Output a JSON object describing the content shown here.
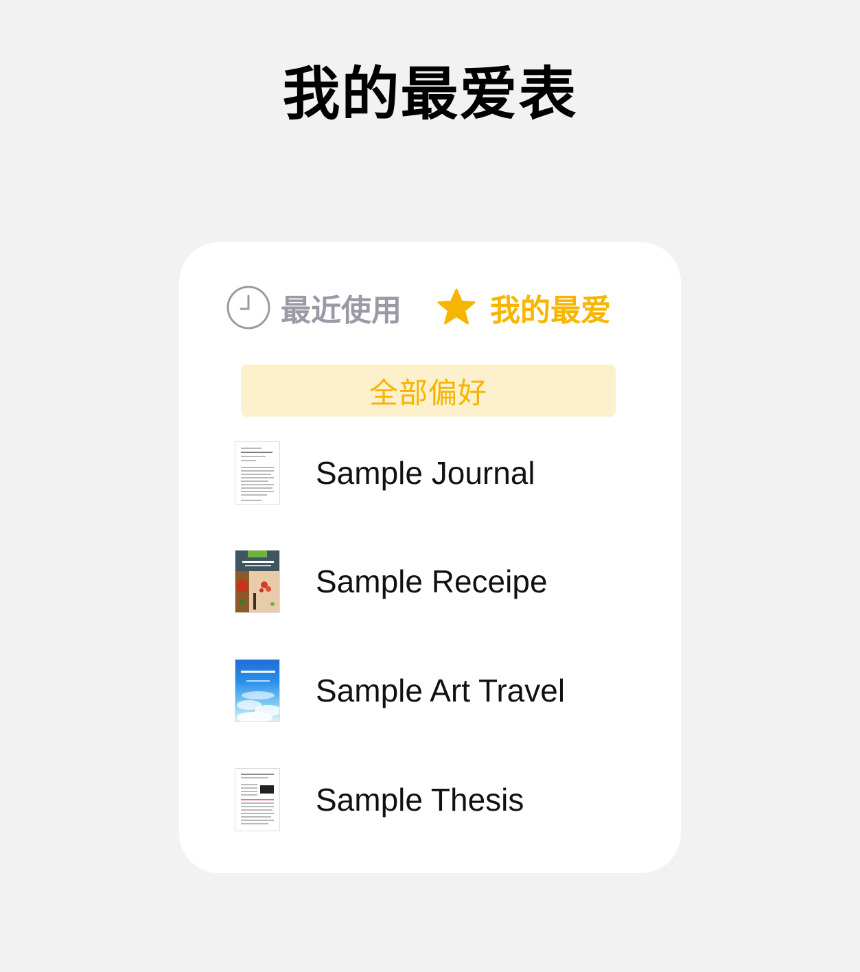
{
  "page": {
    "title": "我的最爱表"
  },
  "tabs": {
    "recent": {
      "label": "最近使用",
      "icon": "clock-icon",
      "color": "#9a9aa6"
    },
    "favorites": {
      "label": "我的最爱",
      "icon": "star-icon",
      "color": "#f6b600",
      "selected": true
    }
  },
  "filter": {
    "label": "全部偏好",
    "background": "#fdf0cc",
    "color": "#f4b400"
  },
  "documents": [
    {
      "title": "Sample Journal",
      "thumbnail": "journal-thumbnail"
    },
    {
      "title": "Sample Receipe",
      "thumbnail": "receipe-thumbnail"
    },
    {
      "title": "Sample Art Travel",
      "thumbnail": "art-travel-thumbnail"
    },
    {
      "title": "Sample Thesis",
      "thumbnail": "thesis-thumbnail"
    }
  ]
}
